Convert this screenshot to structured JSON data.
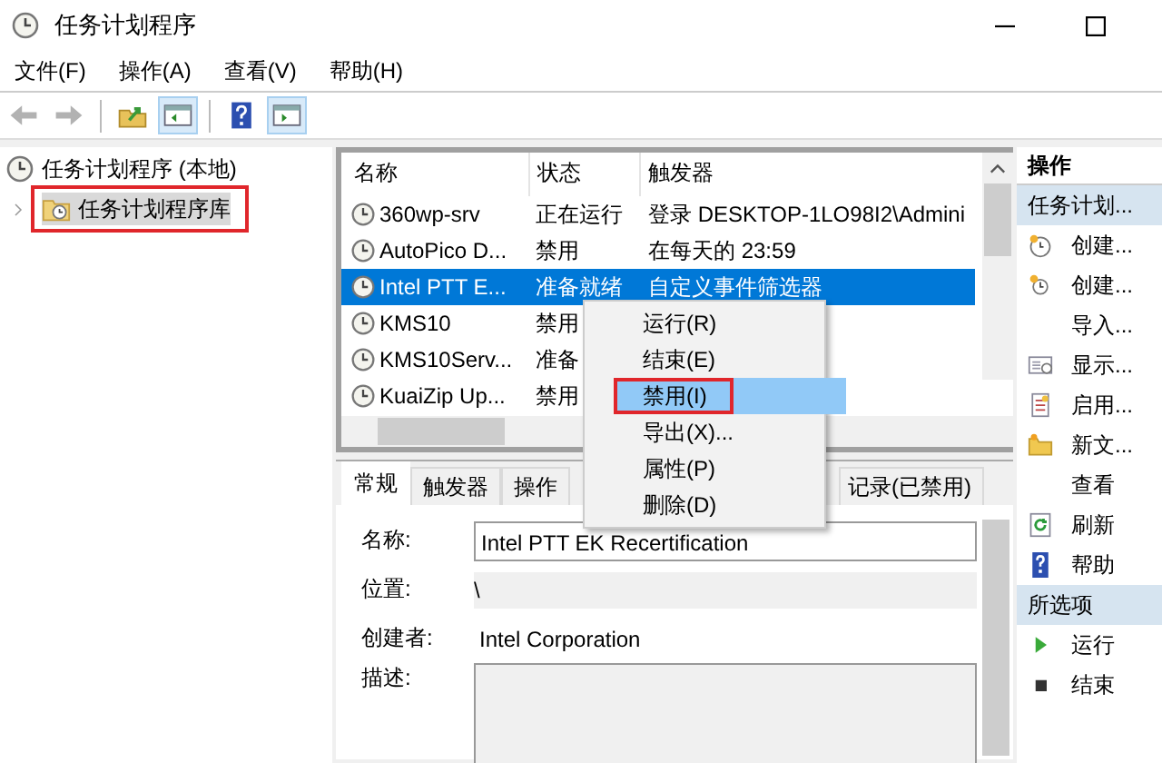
{
  "window": {
    "title": "任务计划程序"
  },
  "menu": [
    "文件(F)",
    "操作(A)",
    "查看(V)",
    "帮助(H)"
  ],
  "toolbar": [
    {
      "kind": "back",
      "disabled": true,
      "selected": false
    },
    {
      "kind": "forward",
      "disabled": true,
      "selected": false
    },
    {
      "kind": "folder-up",
      "disabled": false,
      "selected": false
    },
    {
      "kind": "panel-left",
      "disabled": false,
      "selected": true
    },
    {
      "kind": "help",
      "disabled": false,
      "selected": false
    },
    {
      "kind": "panel-right",
      "disabled": false,
      "selected": true
    }
  ],
  "tree": {
    "label": "任务计划程序 (本地)",
    "children": [
      {
        "label": "任务计划程序库",
        "selected": true,
        "highlighted": true,
        "expanded": false
      }
    ]
  },
  "table": {
    "columns": [
      "名称",
      "状态",
      "触发器"
    ],
    "rows": [
      {
        "cells": [
          "360wp-srv",
          "正在运行",
          "登录 DESKTOP-1LO98I2\\Admini"
        ],
        "selected": false
      },
      {
        "cells": [
          "AutoPico D...",
          "禁用",
          "在每天的 23:59"
        ],
        "selected": false
      },
      {
        "cells": [
          "Intel PTT E...",
          "准备就绪",
          "自定义事件筛选器"
        ],
        "selected": true
      },
      {
        "cells": [
          "KMS10",
          "禁用"
        ],
        "selected": false
      },
      {
        "cells": [
          "KMS10Serv...",
          "准备"
        ],
        "selected": false
      },
      {
        "cells": [
          "KuaiZip Up...",
          "禁用"
        ],
        "selected": false
      }
    ]
  },
  "context_menu": [
    {
      "label": "运行(R)",
      "selected": false,
      "highlighted": false
    },
    {
      "label": "结束(E)",
      "selected": false,
      "highlighted": false
    },
    {
      "label": "禁用(I)",
      "selected": true,
      "highlighted": true
    },
    {
      "label": "导出(X)...",
      "selected": false,
      "highlighted": false
    },
    {
      "label": "属性(P)",
      "selected": false,
      "highlighted": false
    },
    {
      "label": "删除(D)",
      "selected": false,
      "highlighted": false
    }
  ],
  "detail_tabs": [
    {
      "label": "常规",
      "selected": true
    },
    {
      "label": "触发器",
      "selected": false
    },
    {
      "label": "操作",
      "selected": false
    },
    {
      "label": "记录(已禁用)",
      "selected": false
    }
  ],
  "detail_fields": [
    {
      "label": "名称:",
      "kind": "field",
      "value": "Intel PTT EK Recertification"
    },
    {
      "label": "位置:",
      "kind": "readonly",
      "value": "\\"
    },
    {
      "label": "创建者:",
      "kind": "text",
      "value": "Intel Corporation"
    },
    {
      "label": "描述:",
      "kind": "textarea"
    }
  ],
  "actions": {
    "title": "操作",
    "sections": [
      {
        "title": "任务计划...",
        "items": [
          {
            "label": "创建...",
            "kind": "clock-new"
          },
          {
            "label": "创建...",
            "kind": "clock-small"
          },
          {
            "label": "导入...",
            "kind": "none"
          },
          {
            "label": "显示...",
            "kind": "list"
          },
          {
            "label": "启用...",
            "kind": "log"
          },
          {
            "label": "新文...",
            "kind": "folder"
          },
          {
            "label": "查看",
            "kind": "none"
          },
          {
            "label": "刷新",
            "kind": "refresh"
          },
          {
            "label": "帮助",
            "kind": "help"
          }
        ]
      },
      {
        "title": "所选项",
        "items": [
          {
            "label": "运行",
            "kind": "play"
          },
          {
            "label": "结束",
            "kind": "stop"
          }
        ]
      }
    ]
  }
}
